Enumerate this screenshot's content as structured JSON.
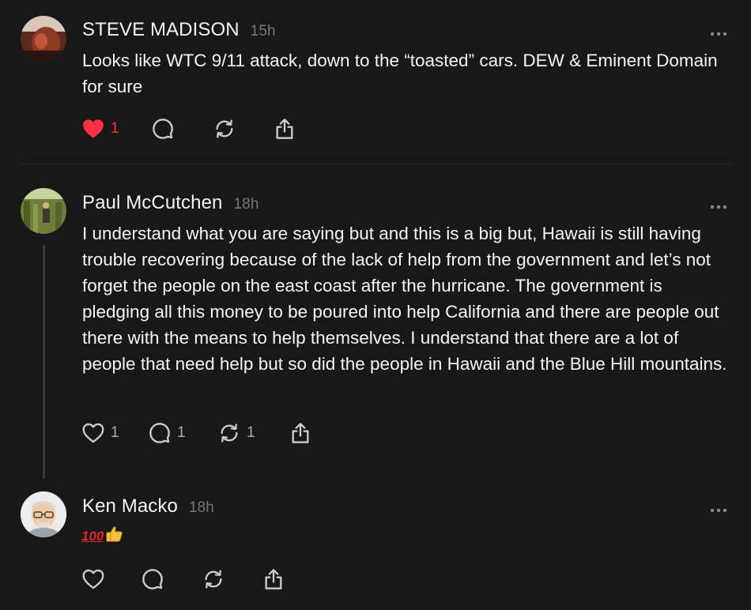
{
  "posts": [
    {
      "author": "STEVE MADISON",
      "time": "15h",
      "text": "Looks like WTC 9/11 attack, down to the “toasted” cars. DEW & Eminent Domain for sure",
      "likes": "1",
      "replies": "",
      "reposts": "",
      "liked": true
    },
    {
      "author": "Paul McCutchen",
      "time": "18h",
      "text": "I understand what you are saying but and this is a big but, Hawaii is still having trouble recovering because of the lack of help from the government and let’s not forget the people on the east coast after the hurricane. The government is pledging all this money to be poured into help California and there are people out there with the means to help themselves. I understand that there are a lot of people that need help but so did the people in Hawaii and the Blue Hill mountains.",
      "likes": "1",
      "replies": "1",
      "reposts": "1",
      "liked": false
    },
    {
      "author": "Ken Macko",
      "time": "18h",
      "text": "💯👍",
      "likes": "",
      "replies": "",
      "reposts": "",
      "liked": false
    }
  ],
  "icons": {
    "like": "heart-icon",
    "reply": "comment-icon",
    "repost": "repost-icon",
    "share": "share-icon",
    "more": "more-icon"
  },
  "colors": {
    "background": "#181818",
    "text": "#f3f5f7",
    "muted": "#777777",
    "like_active": "#ff3040",
    "icon": "#cccccc"
  }
}
